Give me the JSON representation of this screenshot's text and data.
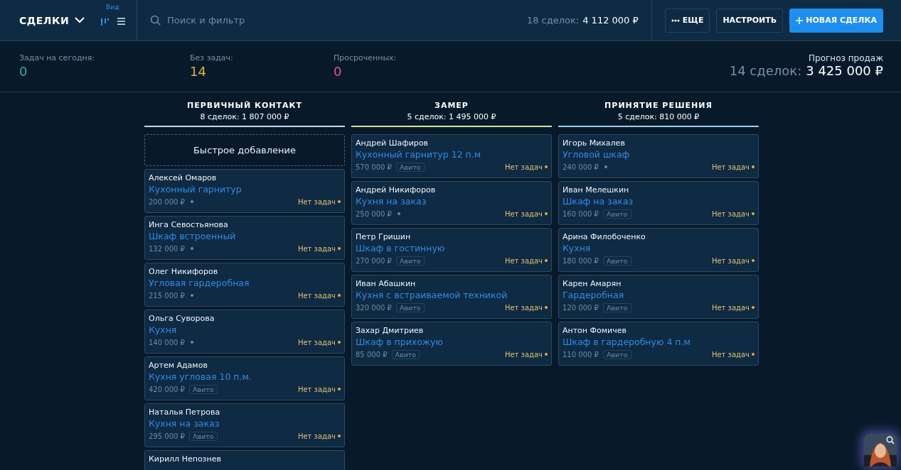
{
  "header": {
    "title": "СДЕЛКИ",
    "view_label": "Вид",
    "views": [
      {
        "kind": "pipeline",
        "selected": true
      },
      {
        "kind": "list",
        "selected": false
      }
    ],
    "search": {
      "placeholder": "Поиск и фильтр"
    },
    "total_label": "18 сделок:",
    "total_value": "4 112 000 ₽",
    "buttons": [
      {
        "kind": "more",
        "label": "ЕЩЕ"
      },
      {
        "kind": "plain",
        "label": "НАСТРОИТЬ"
      },
      {
        "kind": "primary",
        "label": "НОВАЯ СДЕЛКА"
      }
    ]
  },
  "stats": [
    {
      "label": "Задач на сегодня:",
      "value": "0",
      "color": "#2bb39a"
    },
    {
      "label": "Без задач:",
      "value": "14",
      "color": "#e0b23a"
    },
    {
      "label": "Просроченных:",
      "value": "0",
      "color": "#f0508a"
    }
  ],
  "forecast": {
    "label": "Прогноз продаж",
    "count": "14 сделок:",
    "value": "3 425 000 ₽"
  },
  "stages": [
    {
      "title": "ПЕРВИЧНЫЙ КОНТАКТ",
      "summary": "8 сделок: 1 807 000 ₽",
      "color": "#c9d9e8",
      "quick_add": "Быстрое добавление",
      "deals": [
        {
          "name": "Алексей Омаров",
          "title": "Кухонный гарнитур",
          "price": "200 000 ₽",
          "status": "Нет задач"
        },
        {
          "name": "Инга Севостьянова",
          "title": "Шкаф встроенный",
          "price": "132 000 ₽",
          "status": "Нет задач"
        },
        {
          "name": "Олег Никифоров",
          "title": "Угловая гардеробная",
          "price": "215 000 ₽",
          "status": "Нет задач"
        },
        {
          "name": "Ольга Суворова",
          "title": "Кухня",
          "price": "140 000 ₽",
          "status": "Нет задач"
        },
        {
          "name": "Артем Адамов",
          "title": "Кухня угловая 10 п.м.",
          "price": "420 000 ₽",
          "tag": "Авито",
          "status": "Нет задач"
        },
        {
          "name": "Наталья Петрова",
          "title": "Кухня на заказ",
          "price": "295 000 ₽",
          "tag": "Авито",
          "status": "Нет задач"
        },
        {
          "name": "Кирилл Непознев"
        }
      ]
    },
    {
      "title": "ЗАМЕР",
      "summary": "5 сделок: 1 495 000 ₽",
      "color": "#d8e29c",
      "deals": [
        {
          "name": "Андрей Шафиров",
          "title": "Кухонный гарнитур 12 п.м",
          "price": "570 000 ₽",
          "tag": "Авито",
          "status": "Нет задач"
        },
        {
          "name": "Андрей Никифоров",
          "title": "Кухня на заказ",
          "price": "250 000 ₽",
          "status": "Нет задач"
        },
        {
          "name": "Петр Гришин",
          "title": "Шкаф в гостинную",
          "price": "270 000 ₽",
          "tag": "Авито",
          "status": "Нет задач"
        },
        {
          "name": "Иван Абашкин",
          "title": "Кухня с встраиваемой техникой",
          "price": "320 000 ₽",
          "tag": "Авито",
          "status": "Нет задач"
        },
        {
          "name": "Захар Дмитриев",
          "title": "Шкаф в прихожую",
          "price": "85 000 ₽",
          "tag": "Авито",
          "status": "Нет задач"
        }
      ]
    },
    {
      "title": "ПРИНЯТИЕ РЕШЕНИЯ",
      "summary": "5 сделок: 810 000 ₽",
      "color": "#9fcdee",
      "deals": [
        {
          "name": "Игорь Михалев",
          "title": "Угловой шкаф",
          "price": "240 000 ₽",
          "status": "Нет задач"
        },
        {
          "name": "Иван Мелешкин",
          "title": "Шкаф на заказ",
          "price": "160 000 ₽",
          "tag": "Авито",
          "status": "Нет задач"
        },
        {
          "name": "Арина Филобоченко",
          "title": "Кухня",
          "price": "180 000 ₽",
          "tag": "Авито",
          "status": "Нет задач"
        },
        {
          "name": "Карен Амарян",
          "title": "Гардеробная",
          "price": "120 000 ₽",
          "tag": "Авито",
          "status": "Нет задач"
        },
        {
          "name": "Антон Фомичев",
          "title": "Шкаф в гардеробную 4 п.м",
          "price": "110 000 ₽",
          "tag": "Авито",
          "status": "Нет задач"
        }
      ]
    }
  ]
}
